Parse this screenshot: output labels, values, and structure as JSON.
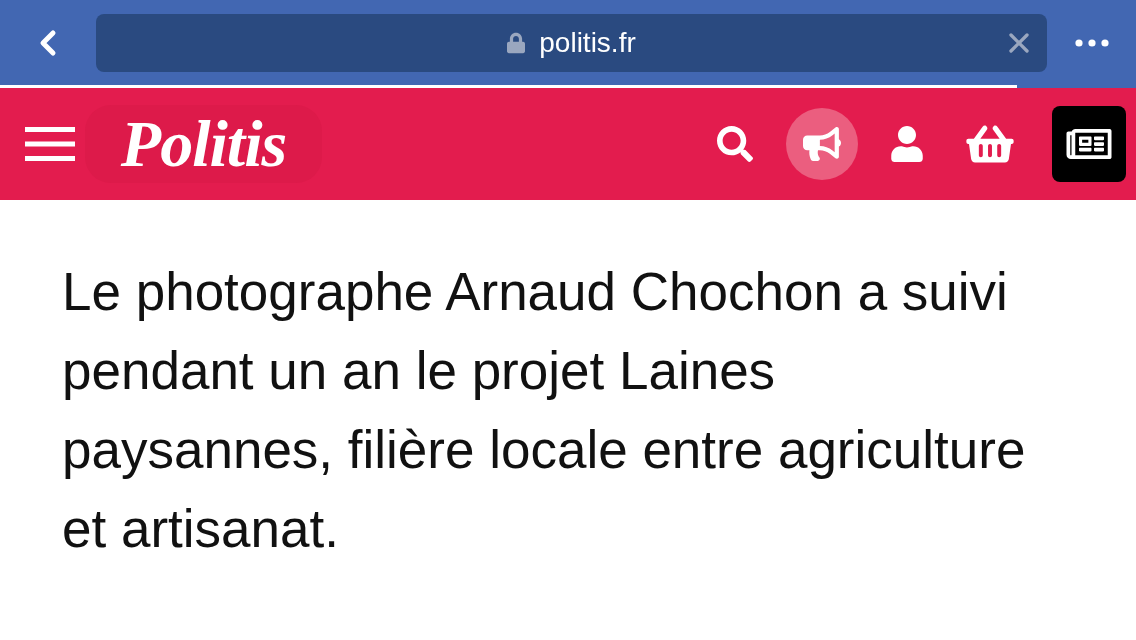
{
  "browser_bar": {
    "url": "politis.fr",
    "load_progress": {
      "level": 0.895
    }
  },
  "site_header": {
    "logo": "Politis"
  },
  "article": {
    "lede": "Le photographe Arnaud Chochon a suivi pendant un an le projet Laines paysannes, filière locale entre agriculture et artisanat."
  }
}
